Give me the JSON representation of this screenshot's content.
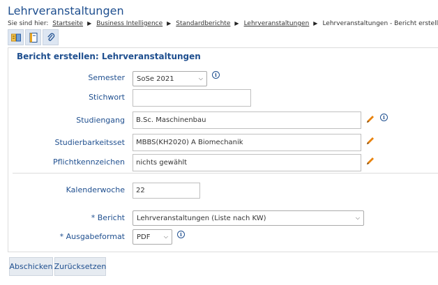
{
  "page": {
    "title": "Lehrveranstaltungen"
  },
  "breadcrumb": {
    "prefix": "Sie sind hier:",
    "items": [
      "Startseite",
      "Business Intelligence",
      "Standardberichte",
      "Lehrveranstaltungen"
    ],
    "current": "Lehrveranstaltungen - Bericht erstellen"
  },
  "toolbar": {
    "icons": [
      "report-compare-icon",
      "document-icon",
      "attachment-icon"
    ]
  },
  "form": {
    "title": "Bericht erstellen: Lehrveranstaltungen",
    "semester": {
      "label": "Semester",
      "value": "SoSe 2021"
    },
    "stichwort": {
      "label": "Stichwort",
      "value": ""
    },
    "studiengang": {
      "label": "Studiengang",
      "value": "B.Sc. Maschinenbau"
    },
    "studierbarkeitsset": {
      "label": "Studierbarkeitsset",
      "value": "MBBS(KH2020) A Biomechanik"
    },
    "pflichtkennzeichen": {
      "label": "Pflichtkennzeichen",
      "value": "nichts gewählt"
    },
    "kalenderwoche": {
      "label": "Kalenderwoche",
      "value": "22"
    },
    "bericht": {
      "label": "* Bericht",
      "value": "Lehrveranstaltungen (Liste nach KW)"
    },
    "ausgabeformat": {
      "label": "* Ausgabeformat",
      "value": "PDF"
    }
  },
  "buttons": {
    "cancel": "Abschicken",
    "reset": "Zurücksetzen"
  },
  "colors": {
    "accent": "#1f4f8f",
    "pencil": "#e8820c"
  }
}
